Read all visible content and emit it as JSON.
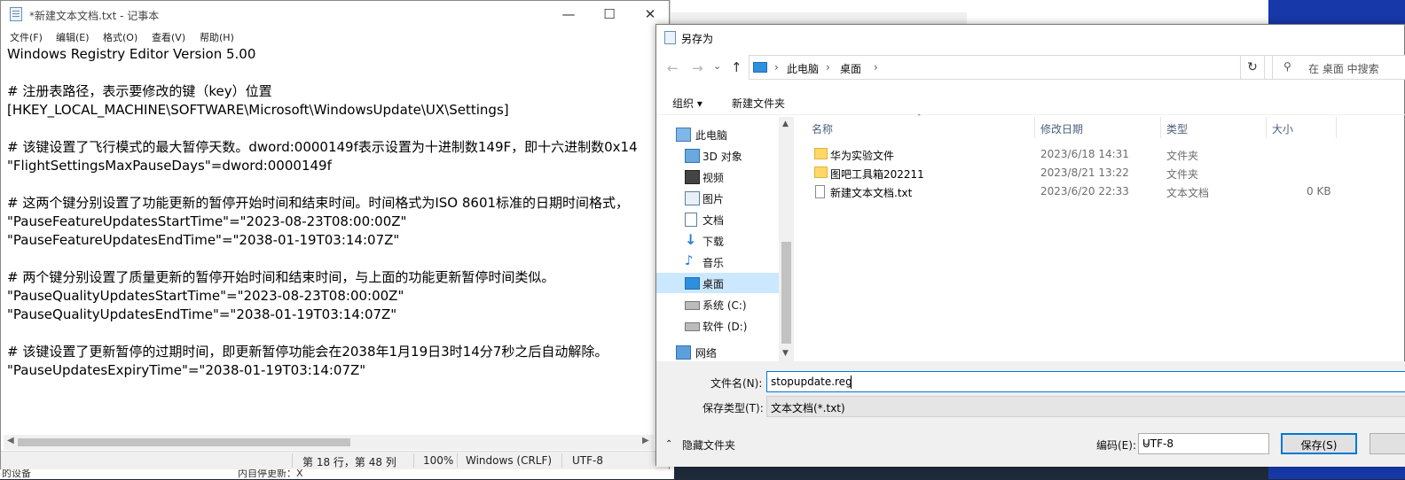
{
  "background": {
    "left_snippets": [
      "的设备",
      "内自停更新：X"
    ]
  },
  "notepad": {
    "title": "*新建文本文档.txt - 记事本",
    "menu": [
      "文件(F)",
      "编辑(E)",
      "格式(O)",
      "查看(V)",
      "帮助(H)"
    ],
    "lines": [
      "Windows Registry Editor Version 5.00",
      "",
      "# 注册表路径，表示要修改的键（key）位置",
      "[HKEY_LOCAL_MACHINE\\SOFTWARE\\Microsoft\\WindowsUpdate\\UX\\Settings]",
      "",
      "# 该键设置了飞行模式的最大暂停天数。dword:0000149f表示设置为十进制数149F，即十六进制数0x14",
      "\"FlightSettingsMaxPauseDays\"=dword:0000149f",
      "",
      "# 这两个键分别设置了功能更新的暂停开始时间和结束时间。时间格式为ISO 8601标准的日期时间格式，",
      "\"PauseFeatureUpdatesStartTime\"=\"2023-08-23T08:00:00Z\"",
      "\"PauseFeatureUpdatesEndTime\"=\"2038-01-19T03:14:07Z\"",
      "",
      "# 两个键分别设置了质量更新的暂停开始时间和结束时间，与上面的功能更新暂停时间类似。",
      "\"PauseQualityUpdatesStartTime\"=\"2023-08-23T08:00:00Z\"",
      "\"PauseQualityUpdatesEndTime\"=\"2038-01-19T03:14:07Z\"",
      "",
      "# 该键设置了更新暂停的过期时间，即更新暂停功能会在2038年1月19日3时14分7秒之后自动解除。",
      "\"PauseUpdatesExpiryTime\"=\"2038-01-19T03:14:07Z\""
    ],
    "status": {
      "position": "第 18 行，第 48 列",
      "zoom": "100%",
      "line_ending": "Windows (CRLF)",
      "encoding": "UTF-8"
    }
  },
  "dialog": {
    "title": "另存为",
    "breadcrumb": [
      "此电脑",
      "桌面"
    ],
    "search_placeholder": "在 桌面 中搜索",
    "toolbar": {
      "organize": "组织 ▾",
      "new_folder": "新建文件夹"
    },
    "nav_items": [
      {
        "label": "此电脑",
        "icon": "computer-icon"
      },
      {
        "label": "3D 对象",
        "icon": "cube-icon"
      },
      {
        "label": "视频",
        "icon": "video-icon"
      },
      {
        "label": "图片",
        "icon": "picture-icon"
      },
      {
        "label": "文档",
        "icon": "document-icon"
      },
      {
        "label": "下载",
        "icon": "download-icon"
      },
      {
        "label": "音乐",
        "icon": "music-icon"
      },
      {
        "label": "桌面",
        "icon": "desktop-icon"
      },
      {
        "label": "系统 (C:)",
        "icon": "drive-icon"
      },
      {
        "label": "软件 (D:)",
        "icon": "drive-icon"
      },
      {
        "label": "网络",
        "icon": "network-icon"
      }
    ],
    "columns": [
      "名称",
      "修改日期",
      "类型",
      "大小"
    ],
    "files": [
      {
        "name": "华为实验文件",
        "date": "2023/6/18 14:31",
        "type": "文件夹",
        "size": "",
        "kind": "folder"
      },
      {
        "name": "图吧工具箱202211",
        "date": "2023/8/21 13:22",
        "type": "文件夹",
        "size": "",
        "kind": "folder"
      },
      {
        "name": "新建文本文档.txt",
        "date": "2023/6/20 22:33",
        "type": "文本文档",
        "size": "0 KB",
        "kind": "txt"
      }
    ],
    "filename_label": "文件名(N):",
    "filename_value": "stopupdate.reg",
    "filetype_label": "保存类型(T):",
    "filetype_value": "文本文档(*.txt)",
    "hide_folders": "隐藏文件夹",
    "encoding_label": "编码(E):",
    "encoding_value": "UTF-8",
    "save_label": "保存(S)"
  },
  "colors": {
    "selection": "#cce8ff",
    "accent": "#0078d7",
    "desktop_blue": "#1638a8"
  }
}
